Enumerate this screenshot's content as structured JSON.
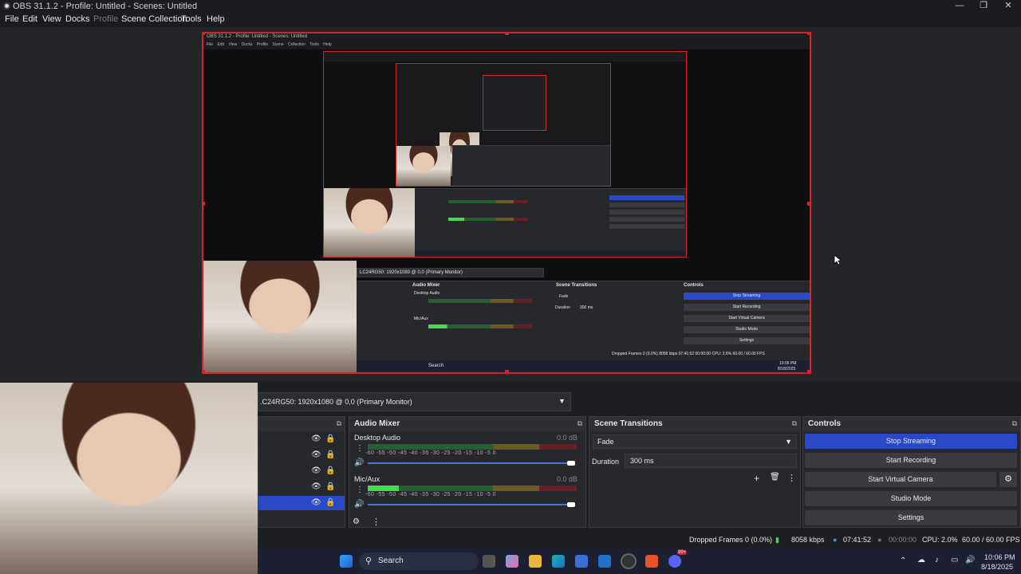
{
  "window": {
    "title": "OBS 31.1.2 - Profile: Untitled - Scenes: Untitled"
  },
  "menu": [
    "File",
    "Edit",
    "View",
    "Docks",
    "Profile",
    "Scene Collection",
    "Tools",
    "Help"
  ],
  "nested": {
    "title": "OBS 31.1.2 - Profile: Untitled - Scenes: Untitled",
    "menu": "File  Edit  View  Docks  Profile  Scene Collection  Tools  Help",
    "source_label": "LC24RG50: 1920x1080 @ 0,0 (Primary Monitor)",
    "mixer_title": "Audio Mixer",
    "desktop_audio": "Desktop Audio",
    "mic": "Mic/Aux",
    "db": "0.0 dB",
    "transitions_title": "Scene Transitions",
    "fade": "Fade",
    "duration_label": "Duration",
    "duration_value": "300 ms",
    "controls_title": "Controls",
    "buttons": [
      "Stop Streaming",
      "Start Recording",
      "Start Virtual Camera",
      "Studio Mode",
      "Settings"
    ],
    "status": "Dropped Frames 0 (0.0%)   8058 kbps   07:41:52   00:00:00   CPU: 2.6%   60.00 / 60.00 FPS",
    "search": "Search",
    "clock": "10:06 PM",
    "date": "8/18/2025"
  },
  "source_bar": {
    "label": ".C24RG50: 1920x1080 @ 0,0 (Primary Monitor)"
  },
  "audio_mixer": {
    "title": "Audio Mixer",
    "channels": [
      {
        "name": "Desktop Audio",
        "db": "0.0 dB",
        "level": 0.0
      },
      {
        "name": "Mic/Aux",
        "db": "0.0 dB",
        "level": 0.15
      }
    ],
    "ticks": [
      "-60",
      "-55",
      "-50",
      "-45",
      "-40",
      "-35",
      "-30",
      "-25",
      "-20",
      "-15",
      "-10",
      "-5",
      "0"
    ]
  },
  "transitions": {
    "title": "Scene Transitions",
    "type": "Fade",
    "duration_label": "Duration",
    "duration_value": "300 ms"
  },
  "controls": {
    "title": "Controls",
    "buttons": [
      "Stop Streaming",
      "Start Recording",
      "Start Virtual Camera",
      "Studio Mode",
      "Settings"
    ]
  },
  "status": {
    "dropped": "Dropped Frames 0 (0.0%)",
    "bitrate": "8058 kbps",
    "stream_time": "07:41:52",
    "rec_time": "00:00:00",
    "cpu": "CPU: 2.0%",
    "fps": "60.00 / 60.00 FPS"
  },
  "taskbar": {
    "search": "Search",
    "time": "10:06 PM",
    "date": "8/18/2025",
    "badge": "99+"
  },
  "colors": {
    "accent": "#2a49c6",
    "selection": "#d4232a",
    "meter_green": "#3ee04a"
  }
}
